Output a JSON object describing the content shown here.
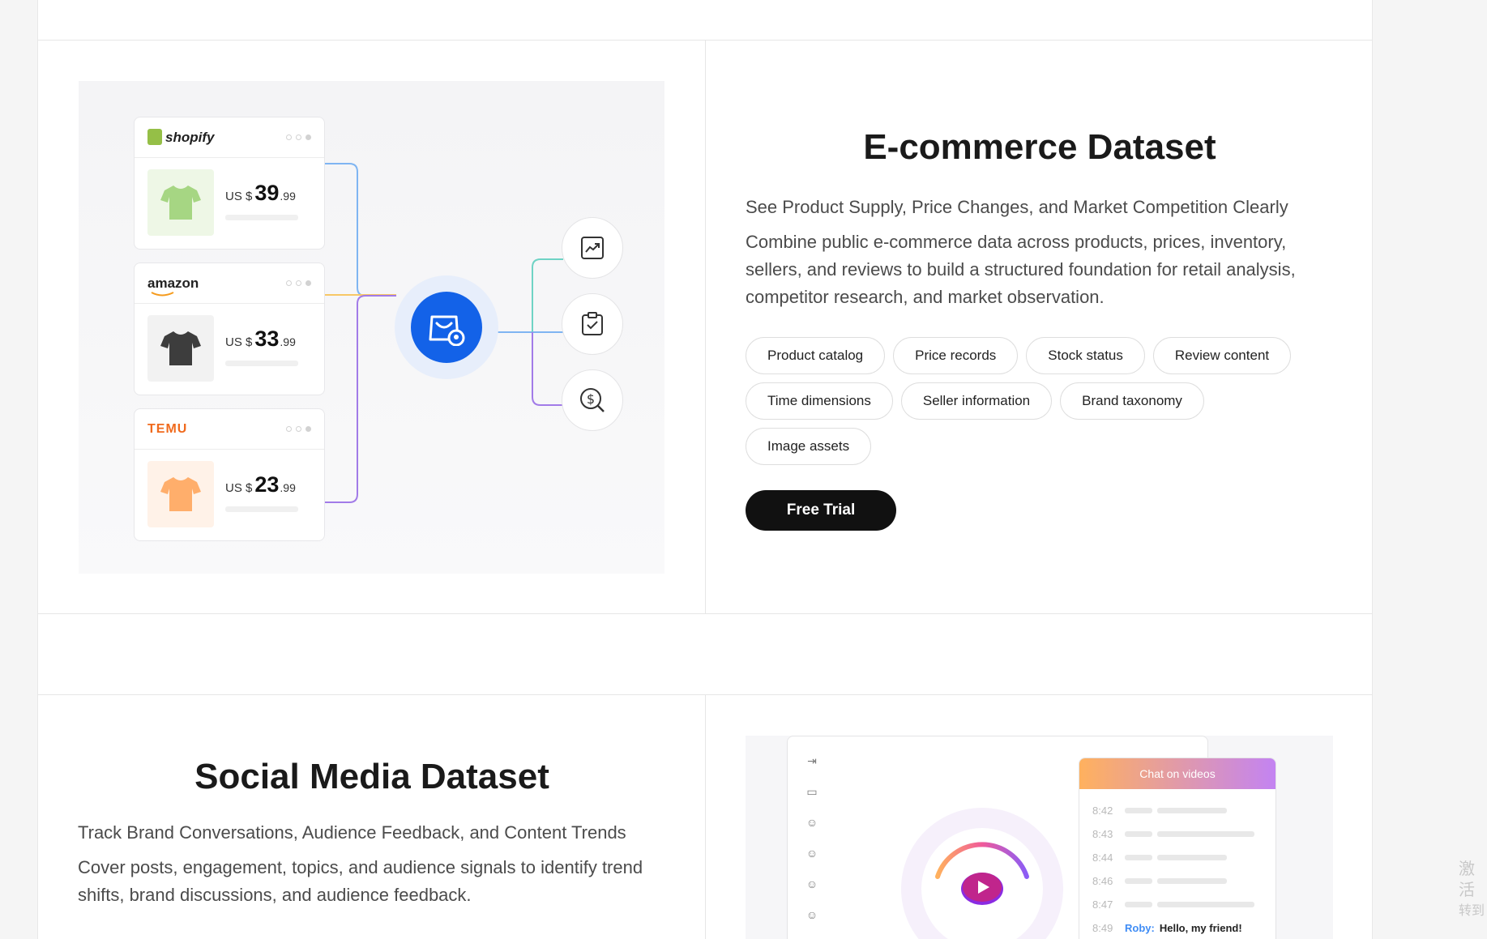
{
  "ecommerce": {
    "title": "E-commerce Dataset",
    "subtitle": "See Product Supply, Price Changes, and Market Competition Clearly",
    "description": "Combine public e-commerce data across products, prices, inventory, sellers, and reviews to build a structured foundation for retail analysis, competitor research, and market observation.",
    "tags": [
      "Product catalog",
      "Price records",
      "Stock status",
      "Review content",
      "Time dimensions",
      "Seller information",
      "Brand taxonomy",
      "Image assets"
    ],
    "cta": "Free Trial",
    "stores": [
      {
        "name": "shopify",
        "currency": "US $",
        "whole": "39",
        "cents": ".99",
        "shirt_color": "#a6d683",
        "bg": "#eef7e6"
      },
      {
        "name": "amazon",
        "currency": "US $",
        "whole": "33",
        "cents": ".99",
        "shirt_color": "#3d3d3d",
        "bg": "#f2f2f2"
      },
      {
        "name": "TEMU",
        "currency": "US $",
        "whole": "23",
        "cents": ".99",
        "shirt_color": "#ffae6b",
        "bg": "#fff2e8"
      }
    ],
    "output_icons": [
      "trend-chart-icon",
      "clipboard-check-icon",
      "dollar-search-icon"
    ],
    "hub_icon": "shopping-bag-location-icon"
  },
  "social": {
    "title": "Social Media Dataset",
    "subtitle": "Track Brand Conversations, Audience Feedback, and Content Trends",
    "description": "Cover posts, engagement, topics, and audience signals to identify trend shifts, brand discussions, and audience feedback.",
    "chat": {
      "header": "Chat on videos",
      "rows": [
        {
          "time": "8:42",
          "bar": 86
        },
        {
          "time": "8:43",
          "bar": 120
        },
        {
          "time": "8:44",
          "bar": 86
        },
        {
          "time": "8:46",
          "bar": 86
        },
        {
          "time": "8:47",
          "bar": 120
        }
      ],
      "last_time": "8:49",
      "last_user": "Roby:",
      "last_message": "Hello, my friend!"
    }
  },
  "side_note": {
    "line1": "激活",
    "line2": "转到"
  }
}
